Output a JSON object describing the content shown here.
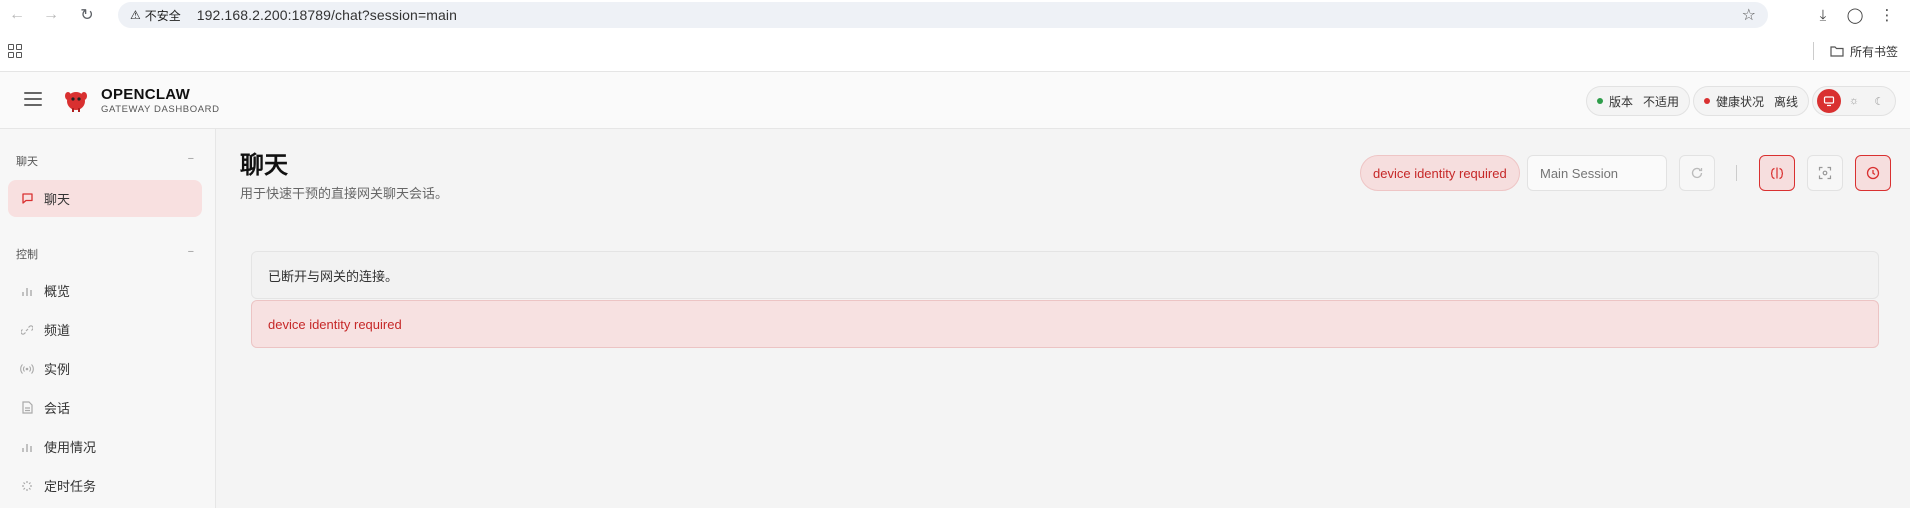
{
  "browser": {
    "insecure_label": "不安全",
    "url": "192.168.2.200:18789/chat?session=main",
    "bookmarks_folder": "所有书签"
  },
  "header": {
    "brand_title": "OPENCLAW",
    "brand_subtitle": "GATEWAY DASHBOARD",
    "version_key": "版本",
    "version_value": "不适用",
    "health_key": "健康状况",
    "health_value": "离线",
    "version_dot_color": "#2e9d4a",
    "health_dot_color": "#d93030"
  },
  "sidebar": {
    "sections": [
      {
        "title": "聊天",
        "collapse": "−"
      },
      {
        "title": "控制",
        "collapse": "−"
      }
    ],
    "items": [
      {
        "label": "聊天",
        "icon": "chat-icon",
        "active": true
      },
      {
        "label": "概览",
        "icon": "bar-chart-icon"
      },
      {
        "label": "频道",
        "icon": "link-icon"
      },
      {
        "label": "实例",
        "icon": "radio-icon"
      },
      {
        "label": "会话",
        "icon": "file-icon"
      },
      {
        "label": "使用情况",
        "icon": "bar-chart-icon"
      },
      {
        "label": "定时任务",
        "icon": "spinner-icon"
      }
    ]
  },
  "main": {
    "title": "聊天",
    "subtitle": "用于快速干预的直接网关聊天会话。",
    "error_chip": "device identity required",
    "session_placeholder": "Main Session",
    "messages": [
      {
        "text": "已断开与网关的连接。",
        "type": "neutral"
      },
      {
        "text": "device identity required",
        "type": "error"
      }
    ]
  },
  "colors": {
    "accent": "#d93030",
    "error_bg": "#f7e1e1"
  }
}
